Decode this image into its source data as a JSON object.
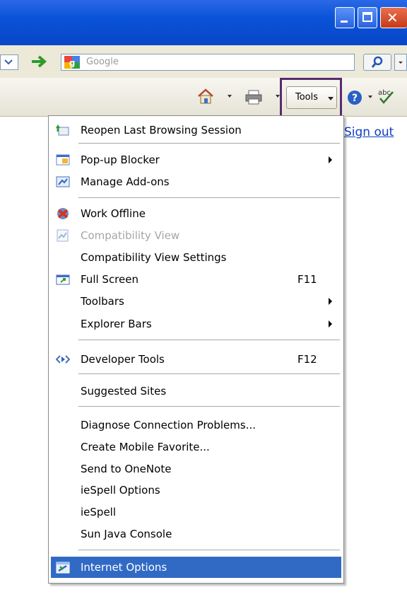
{
  "toolbar": {
    "search_placeholder": "Google",
    "tools_label": "Tools",
    "signout_label": "Sign out"
  },
  "menu": {
    "items": [
      {
        "label": "Reopen Last Browsing Session",
        "icon": "reopen-session-icon"
      },
      {
        "label": "Pop-up Blocker",
        "icon": "popup-blocker-icon",
        "submenu": true
      },
      {
        "label": "Manage Add-ons",
        "icon": "manage-addons-icon"
      },
      {
        "label": "Work Offline",
        "icon": "work-offline-icon"
      },
      {
        "label": "Compatibility View",
        "icon": "compatibility-view-icon",
        "disabled": true
      },
      {
        "label": "Compatibility View Settings"
      },
      {
        "label": "Full Screen",
        "icon": "full-screen-icon",
        "shortcut": "F11"
      },
      {
        "label": "Toolbars",
        "submenu": true
      },
      {
        "label": "Explorer Bars",
        "submenu": true
      },
      {
        "label": "Developer Tools",
        "icon": "developer-tools-icon",
        "shortcut": "F12"
      },
      {
        "label": "Suggested Sites"
      },
      {
        "label": "Diagnose Connection Problems..."
      },
      {
        "label": "Create Mobile Favorite..."
      },
      {
        "label": "Send to OneNote"
      },
      {
        "label": "ieSpell Options"
      },
      {
        "label": "ieSpell"
      },
      {
        "label": "Sun Java Console"
      },
      {
        "label": "Internet Options",
        "icon": "internet-options-icon",
        "selected": true
      }
    ]
  },
  "colors": {
    "titlebar": "#0a53d8",
    "menu_highlight": "#316ac5",
    "tools_outline": "#5a2a6e",
    "link": "#0b3fbf"
  }
}
